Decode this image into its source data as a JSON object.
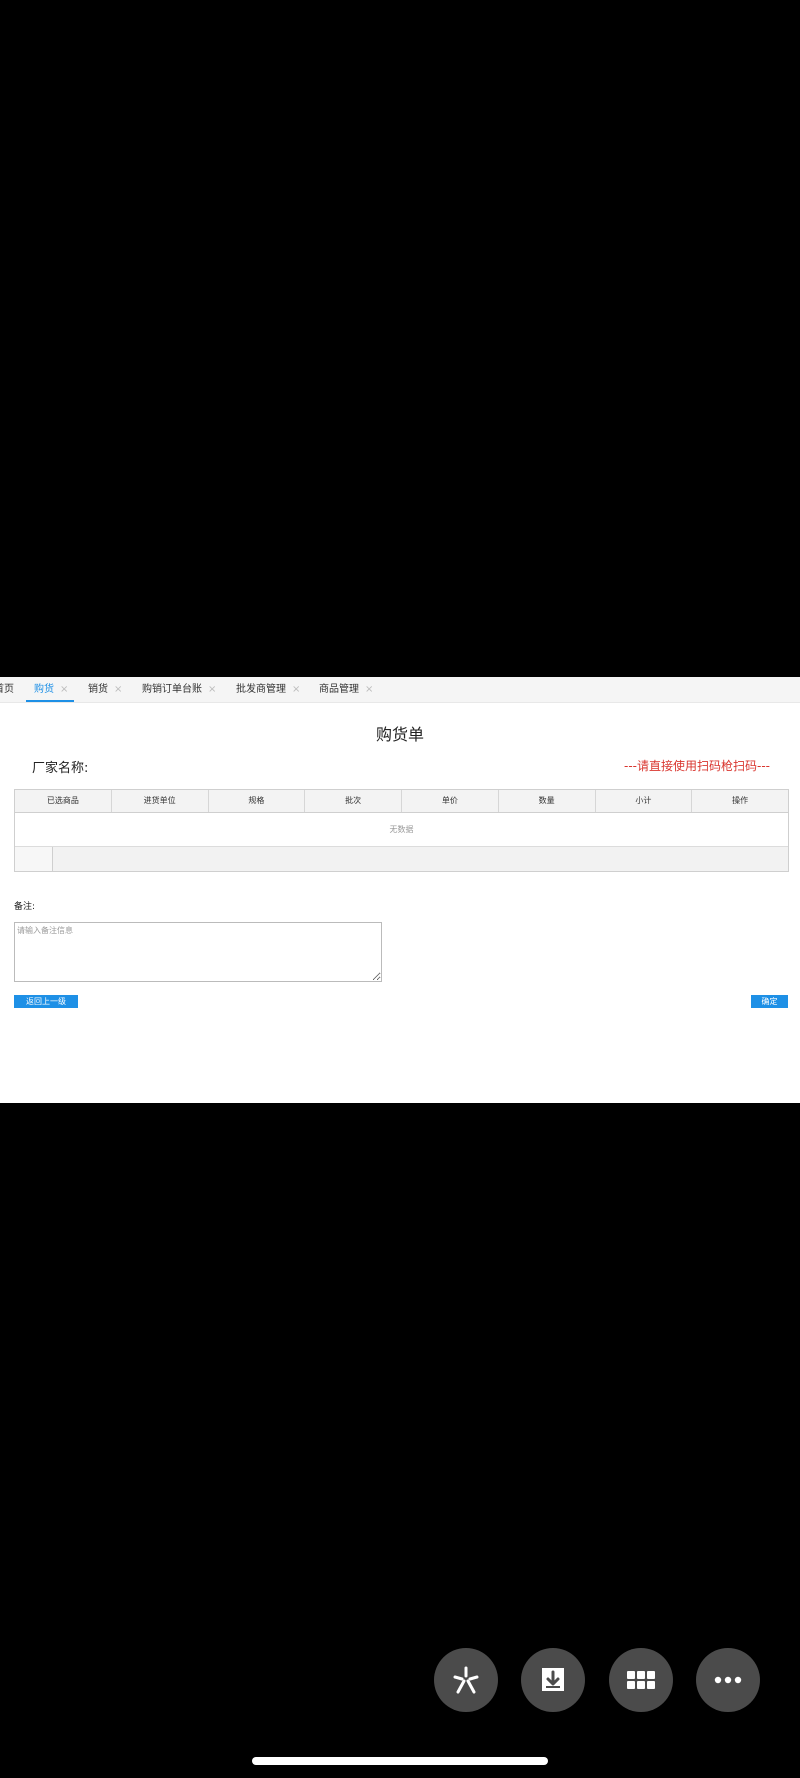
{
  "tabs": [
    {
      "label": "首页",
      "closable": false,
      "active": false
    },
    {
      "label": "购货",
      "closable": true,
      "active": true
    },
    {
      "label": "销货",
      "closable": true,
      "active": false
    },
    {
      "label": "购销订单台账",
      "closable": true,
      "active": false
    },
    {
      "label": "批发商管理",
      "closable": true,
      "active": false
    },
    {
      "label": "商品管理",
      "closable": true,
      "active": false
    }
  ],
  "close_glyph": "×",
  "page": {
    "title": "购货单",
    "vendor_label": "厂家名称:",
    "scan_hint": "---请直接使用扫码枪扫码---"
  },
  "table": {
    "columns": [
      "已选商品",
      "进货单位",
      "规格",
      "批次",
      "单价",
      "数量",
      "小计",
      "操作"
    ],
    "empty_text": "无数据"
  },
  "remarks": {
    "label": "备注:",
    "placeholder": "请输入备注信息",
    "value": ""
  },
  "buttons": {
    "back": "返回上一级",
    "confirm": "确定"
  },
  "fabs": [
    {
      "icon": "asterisk-icon"
    },
    {
      "icon": "download-icon"
    },
    {
      "icon": "grid-icon"
    },
    {
      "icon": "more-icon"
    }
  ],
  "colors": {
    "accent": "#1e90e6",
    "hint": "#d9362f",
    "fab": "#4b4b4b"
  }
}
